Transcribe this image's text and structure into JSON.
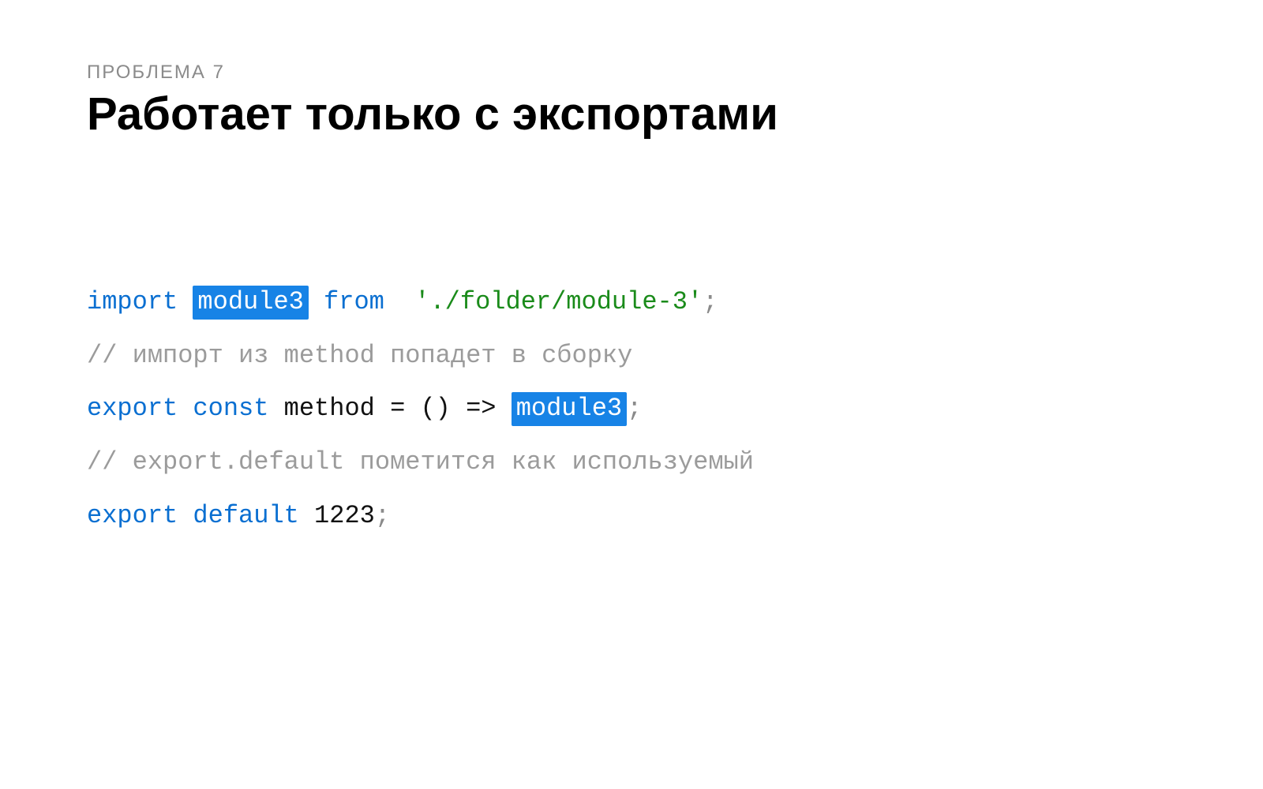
{
  "eyebrow": "ПРОБЛЕМА 7",
  "title": "Работает только с экспортами",
  "code": {
    "line1": {
      "import": "import",
      "module3": "module3",
      "from": "from",
      "path": "'./folder/module-3'",
      "semi": ";"
    },
    "line2": {
      "comment": "// импорт из method попадет в сборку"
    },
    "line3": {
      "export": "export",
      "const": "const",
      "ident": "method = () =>",
      "module3": "module3",
      "semi": ";"
    },
    "line4": {
      "comment": "// export.default пометится как используемый"
    },
    "line5": {
      "export": "export",
      "default": "default",
      "value": "1223",
      "semi": ";"
    }
  }
}
